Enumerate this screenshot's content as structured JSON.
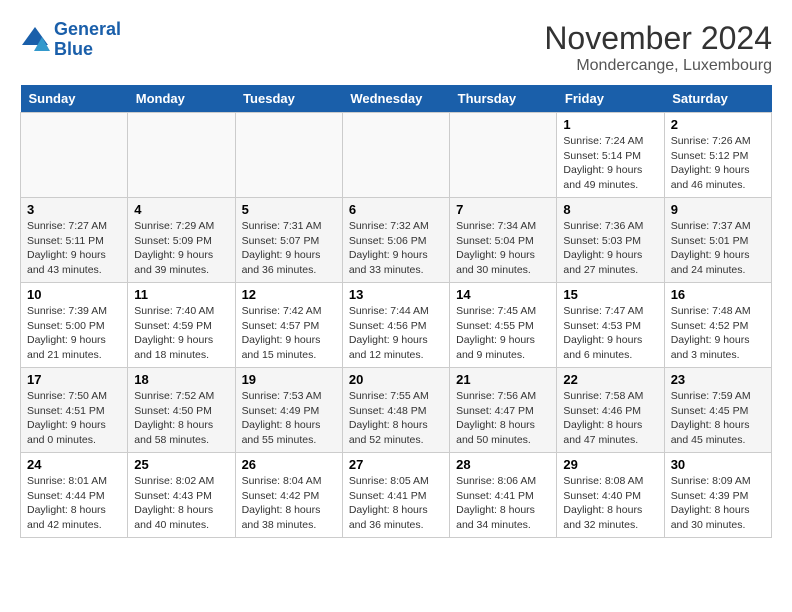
{
  "logo": {
    "line1": "General",
    "line2": "Blue"
  },
  "title": "November 2024",
  "subtitle": "Mondercange, Luxembourg",
  "days_header": [
    "Sunday",
    "Monday",
    "Tuesday",
    "Wednesday",
    "Thursday",
    "Friday",
    "Saturday"
  ],
  "weeks": [
    [
      {
        "day": "",
        "info": ""
      },
      {
        "day": "",
        "info": ""
      },
      {
        "day": "",
        "info": ""
      },
      {
        "day": "",
        "info": ""
      },
      {
        "day": "",
        "info": ""
      },
      {
        "day": "1",
        "info": "Sunrise: 7:24 AM\nSunset: 5:14 PM\nDaylight: 9 hours\nand 49 minutes."
      },
      {
        "day": "2",
        "info": "Sunrise: 7:26 AM\nSunset: 5:12 PM\nDaylight: 9 hours\nand 46 minutes."
      }
    ],
    [
      {
        "day": "3",
        "info": "Sunrise: 7:27 AM\nSunset: 5:11 PM\nDaylight: 9 hours\nand 43 minutes."
      },
      {
        "day": "4",
        "info": "Sunrise: 7:29 AM\nSunset: 5:09 PM\nDaylight: 9 hours\nand 39 minutes."
      },
      {
        "day": "5",
        "info": "Sunrise: 7:31 AM\nSunset: 5:07 PM\nDaylight: 9 hours\nand 36 minutes."
      },
      {
        "day": "6",
        "info": "Sunrise: 7:32 AM\nSunset: 5:06 PM\nDaylight: 9 hours\nand 33 minutes."
      },
      {
        "day": "7",
        "info": "Sunrise: 7:34 AM\nSunset: 5:04 PM\nDaylight: 9 hours\nand 30 minutes."
      },
      {
        "day": "8",
        "info": "Sunrise: 7:36 AM\nSunset: 5:03 PM\nDaylight: 9 hours\nand 27 minutes."
      },
      {
        "day": "9",
        "info": "Sunrise: 7:37 AM\nSunset: 5:01 PM\nDaylight: 9 hours\nand 24 minutes."
      }
    ],
    [
      {
        "day": "10",
        "info": "Sunrise: 7:39 AM\nSunset: 5:00 PM\nDaylight: 9 hours\nand 21 minutes."
      },
      {
        "day": "11",
        "info": "Sunrise: 7:40 AM\nSunset: 4:59 PM\nDaylight: 9 hours\nand 18 minutes."
      },
      {
        "day": "12",
        "info": "Sunrise: 7:42 AM\nSunset: 4:57 PM\nDaylight: 9 hours\nand 15 minutes."
      },
      {
        "day": "13",
        "info": "Sunrise: 7:44 AM\nSunset: 4:56 PM\nDaylight: 9 hours\nand 12 minutes."
      },
      {
        "day": "14",
        "info": "Sunrise: 7:45 AM\nSunset: 4:55 PM\nDaylight: 9 hours\nand 9 minutes."
      },
      {
        "day": "15",
        "info": "Sunrise: 7:47 AM\nSunset: 4:53 PM\nDaylight: 9 hours\nand 6 minutes."
      },
      {
        "day": "16",
        "info": "Sunrise: 7:48 AM\nSunset: 4:52 PM\nDaylight: 9 hours\nand 3 minutes."
      }
    ],
    [
      {
        "day": "17",
        "info": "Sunrise: 7:50 AM\nSunset: 4:51 PM\nDaylight: 9 hours\nand 0 minutes."
      },
      {
        "day": "18",
        "info": "Sunrise: 7:52 AM\nSunset: 4:50 PM\nDaylight: 8 hours\nand 58 minutes."
      },
      {
        "day": "19",
        "info": "Sunrise: 7:53 AM\nSunset: 4:49 PM\nDaylight: 8 hours\nand 55 minutes."
      },
      {
        "day": "20",
        "info": "Sunrise: 7:55 AM\nSunset: 4:48 PM\nDaylight: 8 hours\nand 52 minutes."
      },
      {
        "day": "21",
        "info": "Sunrise: 7:56 AM\nSunset: 4:47 PM\nDaylight: 8 hours\nand 50 minutes."
      },
      {
        "day": "22",
        "info": "Sunrise: 7:58 AM\nSunset: 4:46 PM\nDaylight: 8 hours\nand 47 minutes."
      },
      {
        "day": "23",
        "info": "Sunrise: 7:59 AM\nSunset: 4:45 PM\nDaylight: 8 hours\nand 45 minutes."
      }
    ],
    [
      {
        "day": "24",
        "info": "Sunrise: 8:01 AM\nSunset: 4:44 PM\nDaylight: 8 hours\nand 42 minutes."
      },
      {
        "day": "25",
        "info": "Sunrise: 8:02 AM\nSunset: 4:43 PM\nDaylight: 8 hours\nand 40 minutes."
      },
      {
        "day": "26",
        "info": "Sunrise: 8:04 AM\nSunset: 4:42 PM\nDaylight: 8 hours\nand 38 minutes."
      },
      {
        "day": "27",
        "info": "Sunrise: 8:05 AM\nSunset: 4:41 PM\nDaylight: 8 hours\nand 36 minutes."
      },
      {
        "day": "28",
        "info": "Sunrise: 8:06 AM\nSunset: 4:41 PM\nDaylight: 8 hours\nand 34 minutes."
      },
      {
        "day": "29",
        "info": "Sunrise: 8:08 AM\nSunset: 4:40 PM\nDaylight: 8 hours\nand 32 minutes."
      },
      {
        "day": "30",
        "info": "Sunrise: 8:09 AM\nSunset: 4:39 PM\nDaylight: 8 hours\nand 30 minutes."
      }
    ]
  ]
}
